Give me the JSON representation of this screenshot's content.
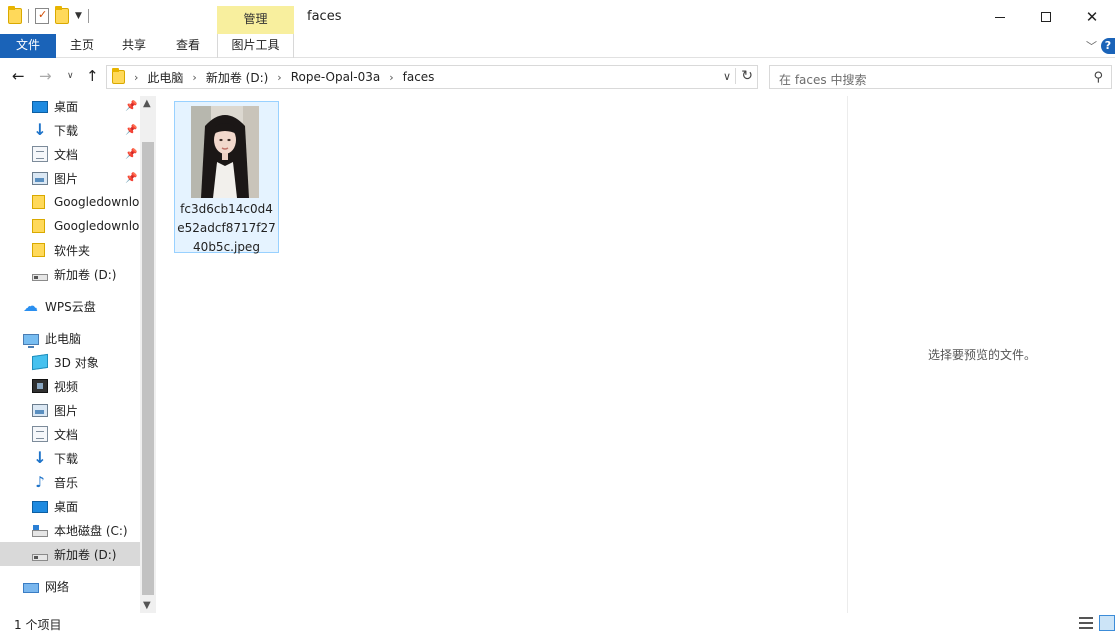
{
  "window": {
    "title": "faces",
    "contextual_tab_group": "管理",
    "colors": {
      "file_tab": "#1a63b8",
      "manage_tab": "#f8ef9e",
      "selection": "#e5f3ff"
    }
  },
  "quick_access_toolbar": {
    "icons": [
      "folder-icon",
      "properties-icon",
      "new-folder-icon",
      "customize-dropdown-icon"
    ]
  },
  "ribbon": {
    "tabs": [
      "文件",
      "主页",
      "共享",
      "查看",
      "图片工具"
    ]
  },
  "navigation": {
    "breadcrumb": [
      "此电脑",
      "新加卷 (D:)",
      "Rope-Opal-03a",
      "faces"
    ],
    "search_placeholder": "在 faces 中搜索"
  },
  "sidebar": {
    "quick_access": [
      {
        "label": "桌面",
        "icon": "desktop-icon",
        "pinned": true
      },
      {
        "label": "下载",
        "icon": "download-icon",
        "pinned": true
      },
      {
        "label": "文档",
        "icon": "document-icon",
        "pinned": true
      },
      {
        "label": "图片",
        "icon": "pictures-icon",
        "pinned": true
      },
      {
        "label": "Googledownlo",
        "icon": "folder-icon",
        "pinned": false
      },
      {
        "label": "Googledownlo",
        "icon": "folder-icon",
        "pinned": false
      },
      {
        "label": "软件夹",
        "icon": "folder-icon",
        "pinned": false
      },
      {
        "label": "新加卷 (D:)",
        "icon": "drive-icon",
        "pinned": false
      }
    ],
    "wps_cloud": "WPS云盘",
    "this_pc": "此电脑",
    "this_pc_items": [
      {
        "label": "3D 对象",
        "icon": "3d-objects-icon"
      },
      {
        "label": "视频",
        "icon": "video-icon"
      },
      {
        "label": "图片",
        "icon": "pictures-icon"
      },
      {
        "label": "文档",
        "icon": "document-icon"
      },
      {
        "label": "下载",
        "icon": "download-icon"
      },
      {
        "label": "音乐",
        "icon": "music-icon"
      },
      {
        "label": "桌面",
        "icon": "desktop-icon"
      },
      {
        "label": "本地磁盘 (C:)",
        "icon": "system-drive-icon"
      },
      {
        "label": "新加卷 (D:)",
        "icon": "drive-icon",
        "selected": true
      }
    ],
    "network": "网络"
  },
  "files": [
    {
      "name": "fc3d6cb14c0d4e52adcf8717f2740b5c.jpeg",
      "name_lines": [
        "fc3d6cb14c0d4",
        "e52adcf8717f27",
        "40b5c.jpeg"
      ],
      "selected": true
    }
  ],
  "preview_pane": {
    "message": "选择要预览的文件。"
  },
  "status": {
    "item_count": "1 个项目"
  }
}
